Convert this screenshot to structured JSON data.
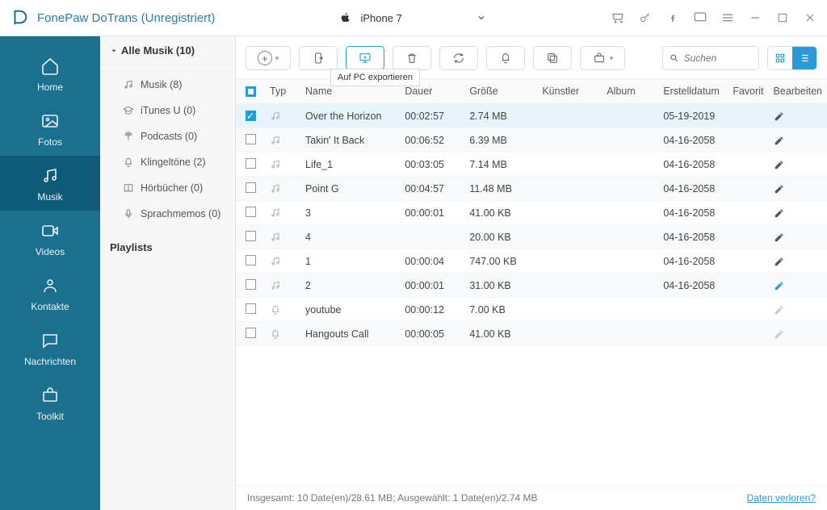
{
  "titlebar": {
    "app_name": "FonePaw DoTrans (Unregistriert)",
    "device": "iPhone 7"
  },
  "sidebar": {
    "items": [
      {
        "label": "Home"
      },
      {
        "label": "Fotos"
      },
      {
        "label": "Musik"
      },
      {
        "label": "Videos"
      },
      {
        "label": "Kontakte"
      },
      {
        "label": "Nachrichten"
      },
      {
        "label": "Toolkit"
      }
    ]
  },
  "mid": {
    "header": "Alle Musik (10)",
    "items": [
      {
        "label": "Musik (8)"
      },
      {
        "label": "iTunes U (0)"
      },
      {
        "label": "Podcasts (0)"
      },
      {
        "label": "Klingeltöne (2)"
      },
      {
        "label": "Hörbücher (0)"
      },
      {
        "label": "Sprachmemos (0)"
      }
    ],
    "playlists_label": "Playlists"
  },
  "toolbar": {
    "tooltip": "Auf PC exportieren",
    "search_placeholder": "Suchen"
  },
  "table": {
    "headers": {
      "typ": "Typ",
      "name": "Name",
      "dauer": "Dauer",
      "groesse": "Größe",
      "kuenstler": "Künstler",
      "album": "Album",
      "erstell": "Erstelldatum",
      "favorit": "Favorit",
      "bearbeiten": "Bearbeiten"
    },
    "rows": [
      {
        "sel": true,
        "icon": "music",
        "name": "Over the Horizon",
        "dur": "00:02:57",
        "size": "2.74 MB",
        "date": "05-19-2019",
        "edit": "n"
      },
      {
        "sel": false,
        "icon": "music",
        "name": "Takin' It Back",
        "dur": "00:06:52",
        "size": "6.39 MB",
        "date": "04-16-2058",
        "edit": "n"
      },
      {
        "sel": false,
        "icon": "music",
        "name": "Life_1",
        "dur": "00:03:05",
        "size": "7.14 MB",
        "date": "04-16-2058",
        "edit": "n"
      },
      {
        "sel": false,
        "icon": "music",
        "name": "Point G",
        "dur": "00:04:57",
        "size": "11.48 MB",
        "date": "04-16-2058",
        "edit": "n"
      },
      {
        "sel": false,
        "icon": "music",
        "name": "3",
        "dur": "00:00:01",
        "size": "41.00 KB",
        "date": "04-16-2058",
        "edit": "n"
      },
      {
        "sel": false,
        "icon": "music",
        "name": "4",
        "dur": "",
        "size": "20.00 KB",
        "date": "04-16-2058",
        "edit": "n"
      },
      {
        "sel": false,
        "icon": "music",
        "name": "1",
        "dur": "00:00:04",
        "size": "747.00 KB",
        "date": "04-16-2058",
        "edit": "n"
      },
      {
        "sel": false,
        "icon": "music",
        "name": "2",
        "dur": "00:00:01",
        "size": "31.00 KB",
        "date": "04-16-2058",
        "edit": "hl"
      },
      {
        "sel": false,
        "icon": "ring",
        "name": "youtube",
        "dur": "00:00:12",
        "size": "7.00 KB",
        "date": "",
        "edit": "dim"
      },
      {
        "sel": false,
        "icon": "ring",
        "name": "Hangouts Call",
        "dur": "00:00:05",
        "size": "41.00 KB",
        "date": "",
        "edit": "dim"
      }
    ]
  },
  "footer": {
    "status": "Insgesamt: 10 Date(en)/28.61 MB; Ausgewählt: 1 Date(en)/2.74 MB",
    "link": "Daten verloren?"
  }
}
